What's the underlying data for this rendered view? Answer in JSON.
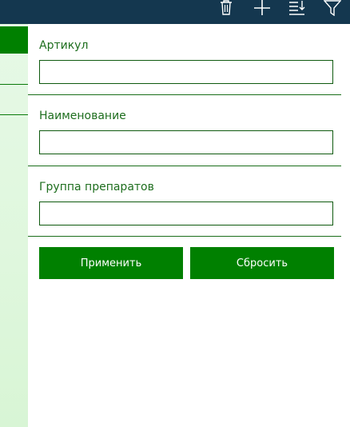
{
  "toolbar": {
    "icons": [
      {
        "name": "trash-icon"
      },
      {
        "name": "plus-icon"
      },
      {
        "name": "sort-icon"
      },
      {
        "name": "filter-icon"
      }
    ]
  },
  "filter": {
    "fields": [
      {
        "label": "Артикул",
        "value": ""
      },
      {
        "label": "Наименование",
        "value": ""
      },
      {
        "label": "Группа препаратов",
        "value": ""
      }
    ],
    "apply_label": "Применить",
    "reset_label": "Сбросить"
  },
  "colors": {
    "topbar": "#14374f",
    "accent_green": "#008000",
    "label_green": "#1e6e1e",
    "panel_light_green": "#dff7dd"
  }
}
